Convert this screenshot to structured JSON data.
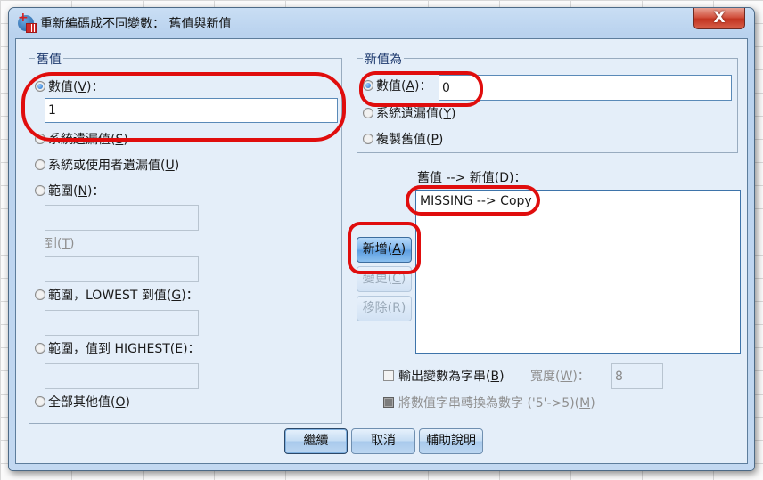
{
  "window": {
    "title": "重新編碼成不同變數： 舊值與新值",
    "close_label": "X",
    "app_icon": "spss-recode-icon"
  },
  "old_value": {
    "legend": "舊值",
    "options": [
      {
        "id": "value",
        "text": "數值",
        "mnemonic": "V",
        "suffix": "：",
        "checked": true
      },
      {
        "id": "system_missing",
        "text": "系統遺漏值",
        "mnemonic": "S",
        "suffix": "",
        "checked": false
      },
      {
        "id": "system_or_user_missing",
        "text": "系統或使用者遺漏值",
        "mnemonic": "U",
        "suffix": "",
        "checked": false
      },
      {
        "id": "range",
        "text": "範圍",
        "mnemonic": "N",
        "suffix": "：",
        "checked": false
      },
      {
        "id": "range_lowest",
        "text": "範圍，LOWEST 到值",
        "mnemonic": "G",
        "suffix": "：",
        "checked": false
      },
      {
        "id": "range_highest_prefix",
        "text": "範圍，值到 HIGH",
        "mnemonic": "E",
        "after": "ST(E)：",
        "checked": false
      },
      {
        "id": "all_other",
        "text": "全部其他值",
        "mnemonic": "O",
        "suffix": "",
        "checked": false
      }
    ],
    "value_input": "1",
    "range_from": "",
    "range_to_label": "到",
    "range_to_mnemonic": "T",
    "range_to": "",
    "lowest_through": "",
    "through_highest": ""
  },
  "new_value": {
    "legend": "新值為",
    "options": [
      {
        "id": "value",
        "text": "數值",
        "mnemonic": "A",
        "suffix": "：",
        "checked": true
      },
      {
        "id": "system_missing",
        "text": "系統遺漏值",
        "mnemonic": "Y",
        "suffix": "",
        "checked": false
      },
      {
        "id": "copy_old",
        "text": "複製舊值",
        "mnemonic": "P",
        "suffix": "",
        "checked": false
      }
    ],
    "value_input": "0"
  },
  "mapping": {
    "label": "舊值 --> 新值",
    "mnemonic": "D",
    "suffix": "：",
    "items": [
      "MISSING --> Copy"
    ]
  },
  "side_buttons": {
    "add": {
      "text": "新增",
      "mnemonic": "A"
    },
    "change": {
      "text": "變更",
      "mnemonic": "C"
    },
    "remove": {
      "text": "移除",
      "mnemonic": "R"
    }
  },
  "string_options": {
    "output_as_string": {
      "text": "輸出變數為字串",
      "mnemonic": "B",
      "checked": false
    },
    "width_label": "寬度",
    "width_mnemonic": "W",
    "width_value": "8",
    "convert_numeric": {
      "text": "將數值字串轉換為數字 ('5'->5)",
      "mnemonic": "M",
      "checked": true
    }
  },
  "footer": {
    "continue": "繼續",
    "cancel": "取消",
    "help": "輔助說明"
  },
  "annotation_color": "#e00d0d"
}
